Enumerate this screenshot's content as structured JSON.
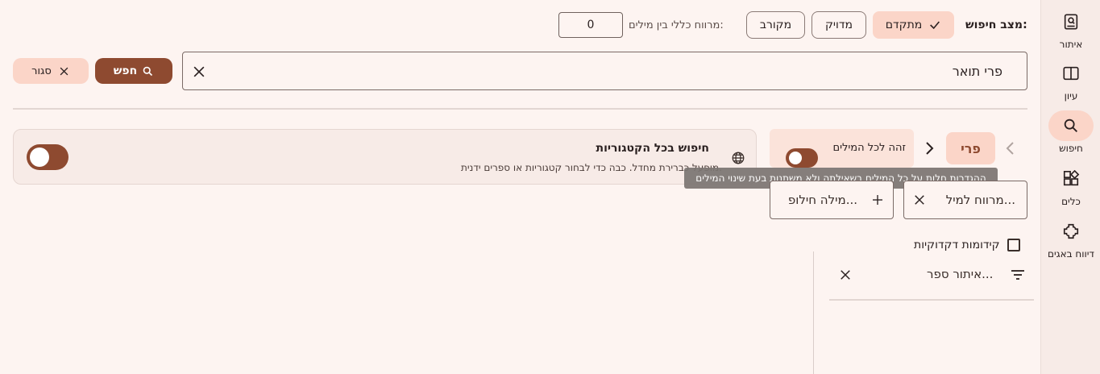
{
  "nav": {
    "items": [
      {
        "label": "איתור",
        "icon": "book-search-icon"
      },
      {
        "label": "עיון",
        "icon": "open-book-icon"
      },
      {
        "label": "חיפוש",
        "icon": "search-icon",
        "active": true
      },
      {
        "label": "כלים",
        "icon": "widgets-icon"
      },
      {
        "label": "דיווח באגים",
        "icon": "bug-report-icon"
      }
    ]
  },
  "search_mode": {
    "label": "מצב חיפוש:",
    "options": [
      {
        "label": "מתקדם",
        "selected": true
      },
      {
        "label": "מדויק",
        "selected": false
      },
      {
        "label": "מקורב",
        "selected": false
      }
    ],
    "distance_label": "מרווח כללי בין מילים:",
    "distance_value": "0"
  },
  "search": {
    "query": "פרי תואר",
    "search_button": "חפש",
    "close_button": "סגור"
  },
  "term": {
    "word": "פרי",
    "all_words_toggle_label": "זהה לכל המילים",
    "all_words_on": true,
    "tooltip": "ההגדרות חלות על כל המילים בשאילתה ולא משתנות בעת שינוי המילים",
    "distance_field": "מרווח למיל...",
    "alt_word_field": "מילה חילופ..."
  },
  "categories": {
    "title": "חיפוש בכל הקטגוריות",
    "description": "מופעל כברירת מחדל. כבה כדי לבחור קטגוריות או ספרים ידנית.",
    "enabled": true
  },
  "filters": {
    "grammar_prefixes_label": "קידומות דקדוקיות",
    "grammar_prefixes_checked": false,
    "book_filter_placeholder": "איתור ספר..."
  },
  "colors": {
    "accent": "#8e4a30",
    "accent_light": "#fbd5c8",
    "background": "#fdf4f1"
  }
}
